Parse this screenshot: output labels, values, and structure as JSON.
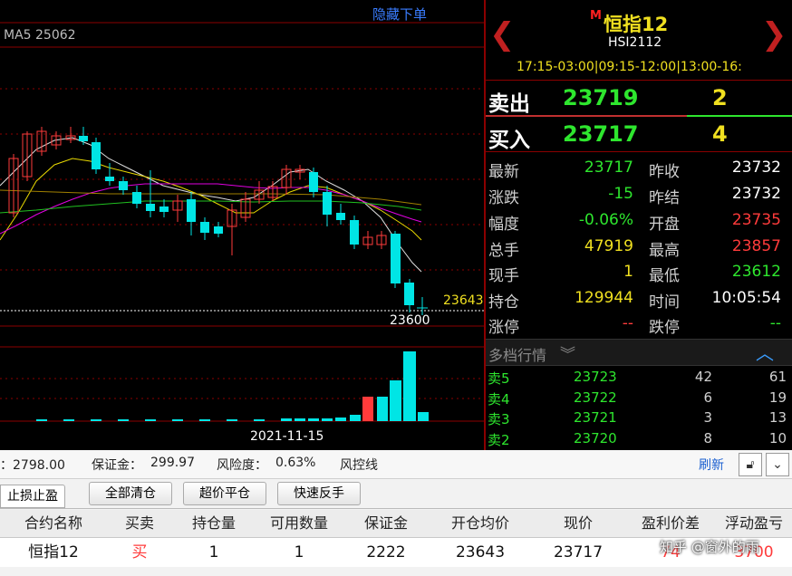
{
  "chart": {
    "hide_orders_link": "隐藏下单",
    "ma5_label": "MA5 25062",
    "last_price_tag": "23643",
    "low_price_tag": "23600",
    "date_label": "2021-11-15"
  },
  "header": {
    "badge": "M",
    "name": "恒指12",
    "code": "HSI2112",
    "sessions": "17:15-03:00|09:15-12:00|13:00-16:"
  },
  "quote": {
    "sell_label": "卖出",
    "sell_price": "23719",
    "sell_qty": "2",
    "buy_label": "买入",
    "buy_price": "23717",
    "buy_qty": "4"
  },
  "stats": {
    "latest_label": "最新",
    "latest": "23717",
    "prev_close_label": "昨收",
    "prev_close": "23732",
    "change_label": "涨跌",
    "change": "-15",
    "prev_settle_label": "昨结",
    "prev_settle": "23732",
    "pct_label": "幅度",
    "pct": "-0.06%",
    "open_label": "开盘",
    "open": "23735",
    "volume_label": "总手",
    "volume": "47919",
    "high_label": "最高",
    "high": "23857",
    "cur_label": "现手",
    "cur": "1",
    "low_label": "最低",
    "low": "23612",
    "oi_label": "持仓",
    "oi": "129944",
    "time_label": "时间",
    "time": "10:05:54",
    "limit_up_label": "涨停",
    "limit_up": "--",
    "limit_down_label": "跌停",
    "limit_down": "--"
  },
  "depth": {
    "title": "多档行情",
    "rows": [
      {
        "label": "卖5",
        "price": "23723",
        "qty": "42",
        "total": "61"
      },
      {
        "label": "卖4",
        "price": "23722",
        "qty": "6",
        "total": "19"
      },
      {
        "label": "卖3",
        "price": "23721",
        "qty": "3",
        "total": "13"
      },
      {
        "label": "卖2",
        "price": "23720",
        "qty": "8",
        "total": "10"
      }
    ]
  },
  "account": {
    "balance_partial": "：2798.00",
    "margin_label": "保证金：",
    "margin": "299.97",
    "risk_label": "风险度：",
    "risk": "0.63%",
    "risk_line": "风控线",
    "refresh": "刷新"
  },
  "buttons": {
    "stop_tab": "止损止盈",
    "close_all": "全部清仓",
    "over_close": "超价平仓",
    "reverse": "快速反手"
  },
  "table": {
    "headers": [
      "合约名称",
      "买卖",
      "持仓量",
      "可用数量",
      "保证金",
      "开仓均价",
      "现价",
      "盈利价差",
      "浮动盈亏"
    ],
    "row": [
      "恒指12",
      "买",
      "1",
      "1",
      "2222",
      "23643",
      "23717",
      "74",
      "3700"
    ]
  },
  "watermark": "知乎 @窗外的雨",
  "colors": {
    "up": "#ff3b3b",
    "down": "#2ee62e",
    "flat": "#f0e020",
    "accent": "#8b0000",
    "candle_down": "#00e5e5"
  }
}
